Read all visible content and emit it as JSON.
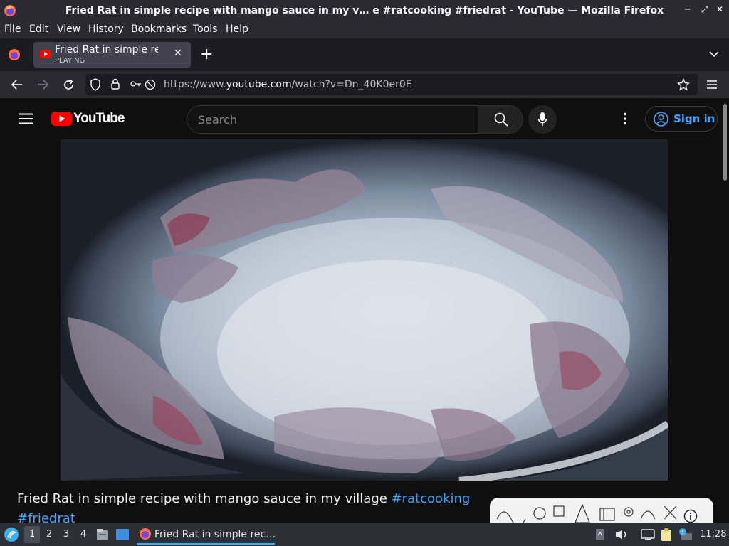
{
  "window": {
    "title": "Fried Rat in simple recipe with mango sauce in my v… e #ratcooking #friedrat - YouTube — Mozilla Firefox"
  },
  "menu": [
    "File",
    "Edit",
    "View",
    "History",
    "Bookmarks",
    "Tools",
    "Help"
  ],
  "tab": {
    "title": "Fried Rat in simple recipe with mango sauce in my village",
    "status": "PLAYING"
  },
  "address": {
    "prefix": "https://www.",
    "domain": "youtube.com",
    "path": "/watch?v=Dn_40K0er0E"
  },
  "youtube": {
    "logo_text": "YouTube",
    "search_placeholder": "Search",
    "signin_label": "Sign in",
    "video_title": "Fried Rat in simple recipe with mango sauce in my village ",
    "hashtags": [
      "#ratcooking",
      "#friedrat"
    ]
  },
  "taskbar": {
    "workspaces": [
      "1",
      "2",
      "3",
      "4"
    ],
    "active_app": "Fried Rat in simple rec…",
    "clock": "11:28"
  },
  "colors": {
    "accent_blue": "#3ea6ff",
    "youtube_red": "#ff0000",
    "taskbar_highlight": "#3daee9"
  }
}
